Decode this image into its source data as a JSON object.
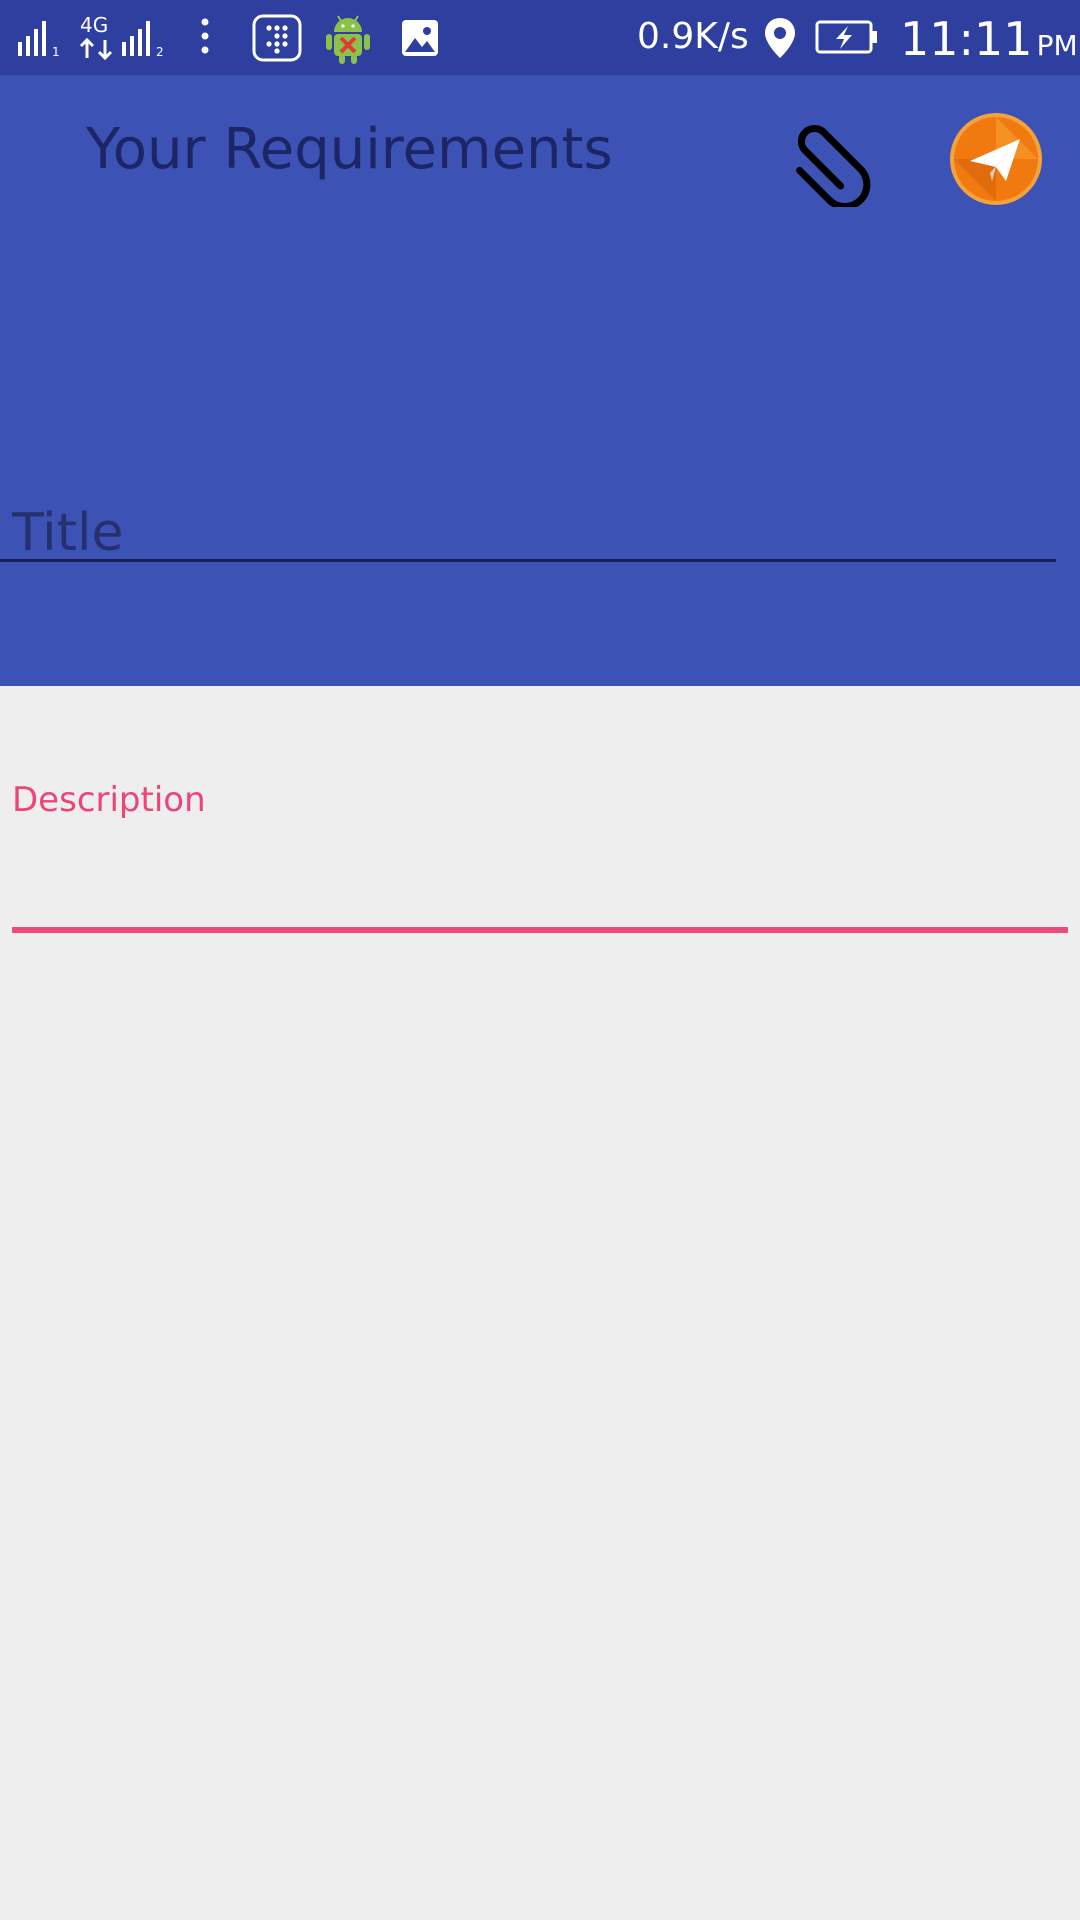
{
  "status_bar": {
    "network_speed": "0.9K/s",
    "time": "11:11",
    "ampm": "PM",
    "icons": [
      "signal-sim1-icon",
      "4g-data-icon",
      "signal-sim2-icon",
      "more-dots-icon",
      "dialpad-icon",
      "android-debug-icon",
      "image-icon",
      "location-icon",
      "battery-charging-icon"
    ]
  },
  "app_bar": {
    "title": "Your Requirements",
    "attach_icon": "paperclip-icon",
    "send_icon": "paper-plane-icon"
  },
  "form": {
    "title_placeholder": "Title",
    "title_value": "",
    "description_label": "Description",
    "description_value": ""
  },
  "colors": {
    "status_bar": "#2f3fa0",
    "header": "#3d52b5",
    "accent": "#ef4a7c",
    "background": "#eeeeef",
    "send_button": "#f07a10"
  }
}
